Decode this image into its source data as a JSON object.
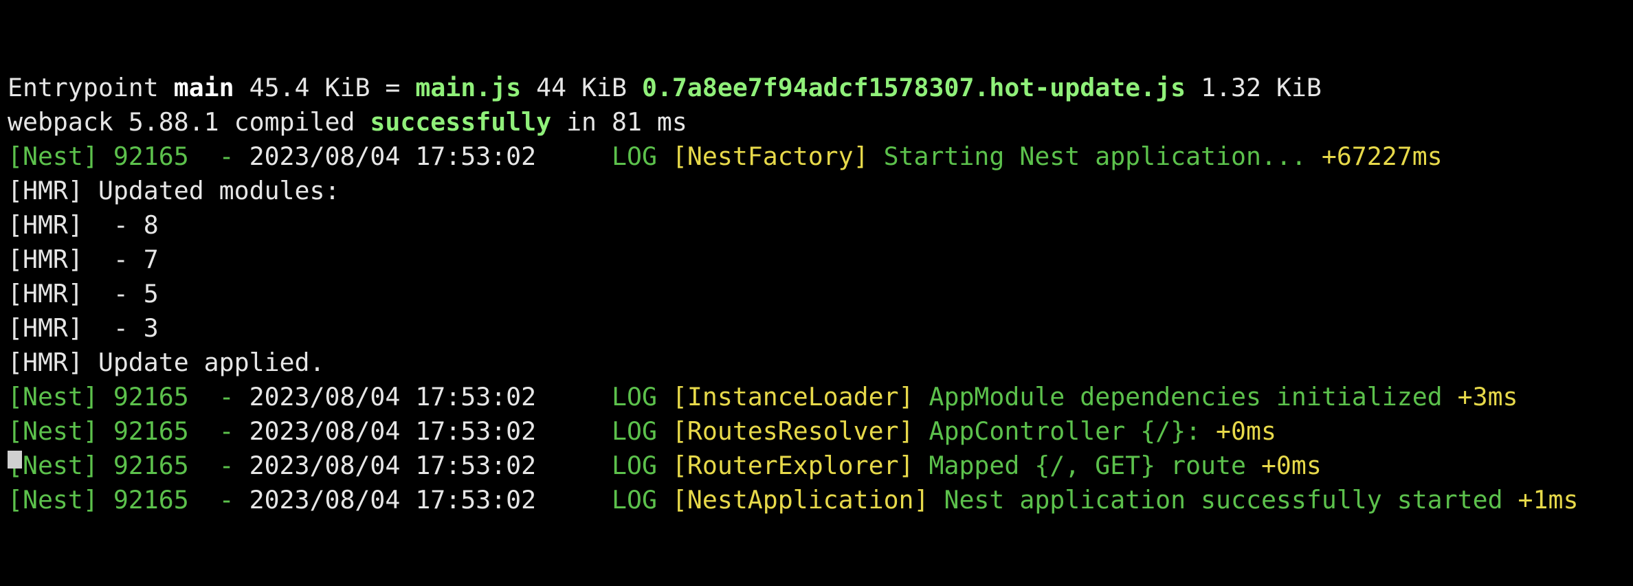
{
  "colors": {
    "background": "#000000",
    "default_text": "#e6e6e6",
    "nest_green": "#5cc14c",
    "bright_green": "#90f07a",
    "context_yellow": "#e7d94a"
  },
  "lines": [
    {
      "segments": [
        {
          "text": "Entrypoint ",
          "style": "w"
        },
        {
          "text": "main",
          "style": "wb"
        },
        {
          "text": " 45.4 KiB = ",
          "style": "w"
        },
        {
          "text": "main.js",
          "style": "gb"
        },
        {
          "text": " 44 KiB ",
          "style": "w"
        },
        {
          "text": "0.7a8ee7f94adcf1578307.hot-update.js",
          "style": "gb"
        },
        {
          "text": " 1.32 KiB",
          "style": "w"
        }
      ]
    },
    {
      "segments": [
        {
          "text": "webpack 5.88.1 compiled ",
          "style": "w"
        },
        {
          "text": "successfully",
          "style": "gb"
        },
        {
          "text": " in 81 ms",
          "style": "w"
        }
      ]
    },
    {
      "segments": [
        {
          "text": "[Nest] 92165  - ",
          "style": "g"
        },
        {
          "text": "2023/08/04 17:53:02",
          "style": "w"
        },
        {
          "text": "     LOG ",
          "style": "g"
        },
        {
          "text": "[NestFactory] ",
          "style": "y"
        },
        {
          "text": "Starting Nest application...",
          "style": "g"
        },
        {
          "text": " +67227ms",
          "style": "y"
        }
      ]
    },
    {
      "segments": [
        {
          "text": "[HMR] Updated modules:",
          "style": "w"
        }
      ]
    },
    {
      "segments": [
        {
          "text": "[HMR]  - 8",
          "style": "w"
        }
      ]
    },
    {
      "segments": [
        {
          "text": "[HMR]  - 7",
          "style": "w"
        }
      ]
    },
    {
      "segments": [
        {
          "text": "[HMR]  - 5",
          "style": "w"
        }
      ]
    },
    {
      "segments": [
        {
          "text": "[HMR]  - 3",
          "style": "w"
        }
      ]
    },
    {
      "segments": [
        {
          "text": "[HMR] Update applied.",
          "style": "w"
        }
      ]
    },
    {
      "segments": [
        {
          "text": "[Nest] 92165  - ",
          "style": "g"
        },
        {
          "text": "2023/08/04 17:53:02",
          "style": "w"
        },
        {
          "text": "     LOG ",
          "style": "g"
        },
        {
          "text": "[InstanceLoader] ",
          "style": "y"
        },
        {
          "text": "AppModule dependencies initialized",
          "style": "g"
        },
        {
          "text": " +3ms",
          "style": "y"
        }
      ]
    },
    {
      "segments": [
        {
          "text": "[Nest] 92165  - ",
          "style": "g"
        },
        {
          "text": "2023/08/04 17:53:02",
          "style": "w"
        },
        {
          "text": "     LOG ",
          "style": "g"
        },
        {
          "text": "[RoutesResolver] ",
          "style": "y"
        },
        {
          "text": "AppController {/}:",
          "style": "g"
        },
        {
          "text": " +0ms",
          "style": "y"
        }
      ]
    },
    {
      "segments": [
        {
          "text": "[Nest] 92165  - ",
          "style": "g"
        },
        {
          "text": "2023/08/04 17:53:02",
          "style": "w"
        },
        {
          "text": "     LOG ",
          "style": "g"
        },
        {
          "text": "[RouterExplorer] ",
          "style": "y"
        },
        {
          "text": "Mapped {/, GET} route",
          "style": "g"
        },
        {
          "text": " +0ms",
          "style": "y"
        }
      ]
    },
    {
      "segments": [
        {
          "text": "[Nest] 92165  - ",
          "style": "g"
        },
        {
          "text": "2023/08/04 17:53:02",
          "style": "w"
        },
        {
          "text": "     LOG ",
          "style": "g"
        },
        {
          "text": "[NestApplication] ",
          "style": "y"
        },
        {
          "text": "Nest application successfully started",
          "style": "g"
        },
        {
          "text": " +1ms",
          "style": "y"
        }
      ]
    }
  ]
}
